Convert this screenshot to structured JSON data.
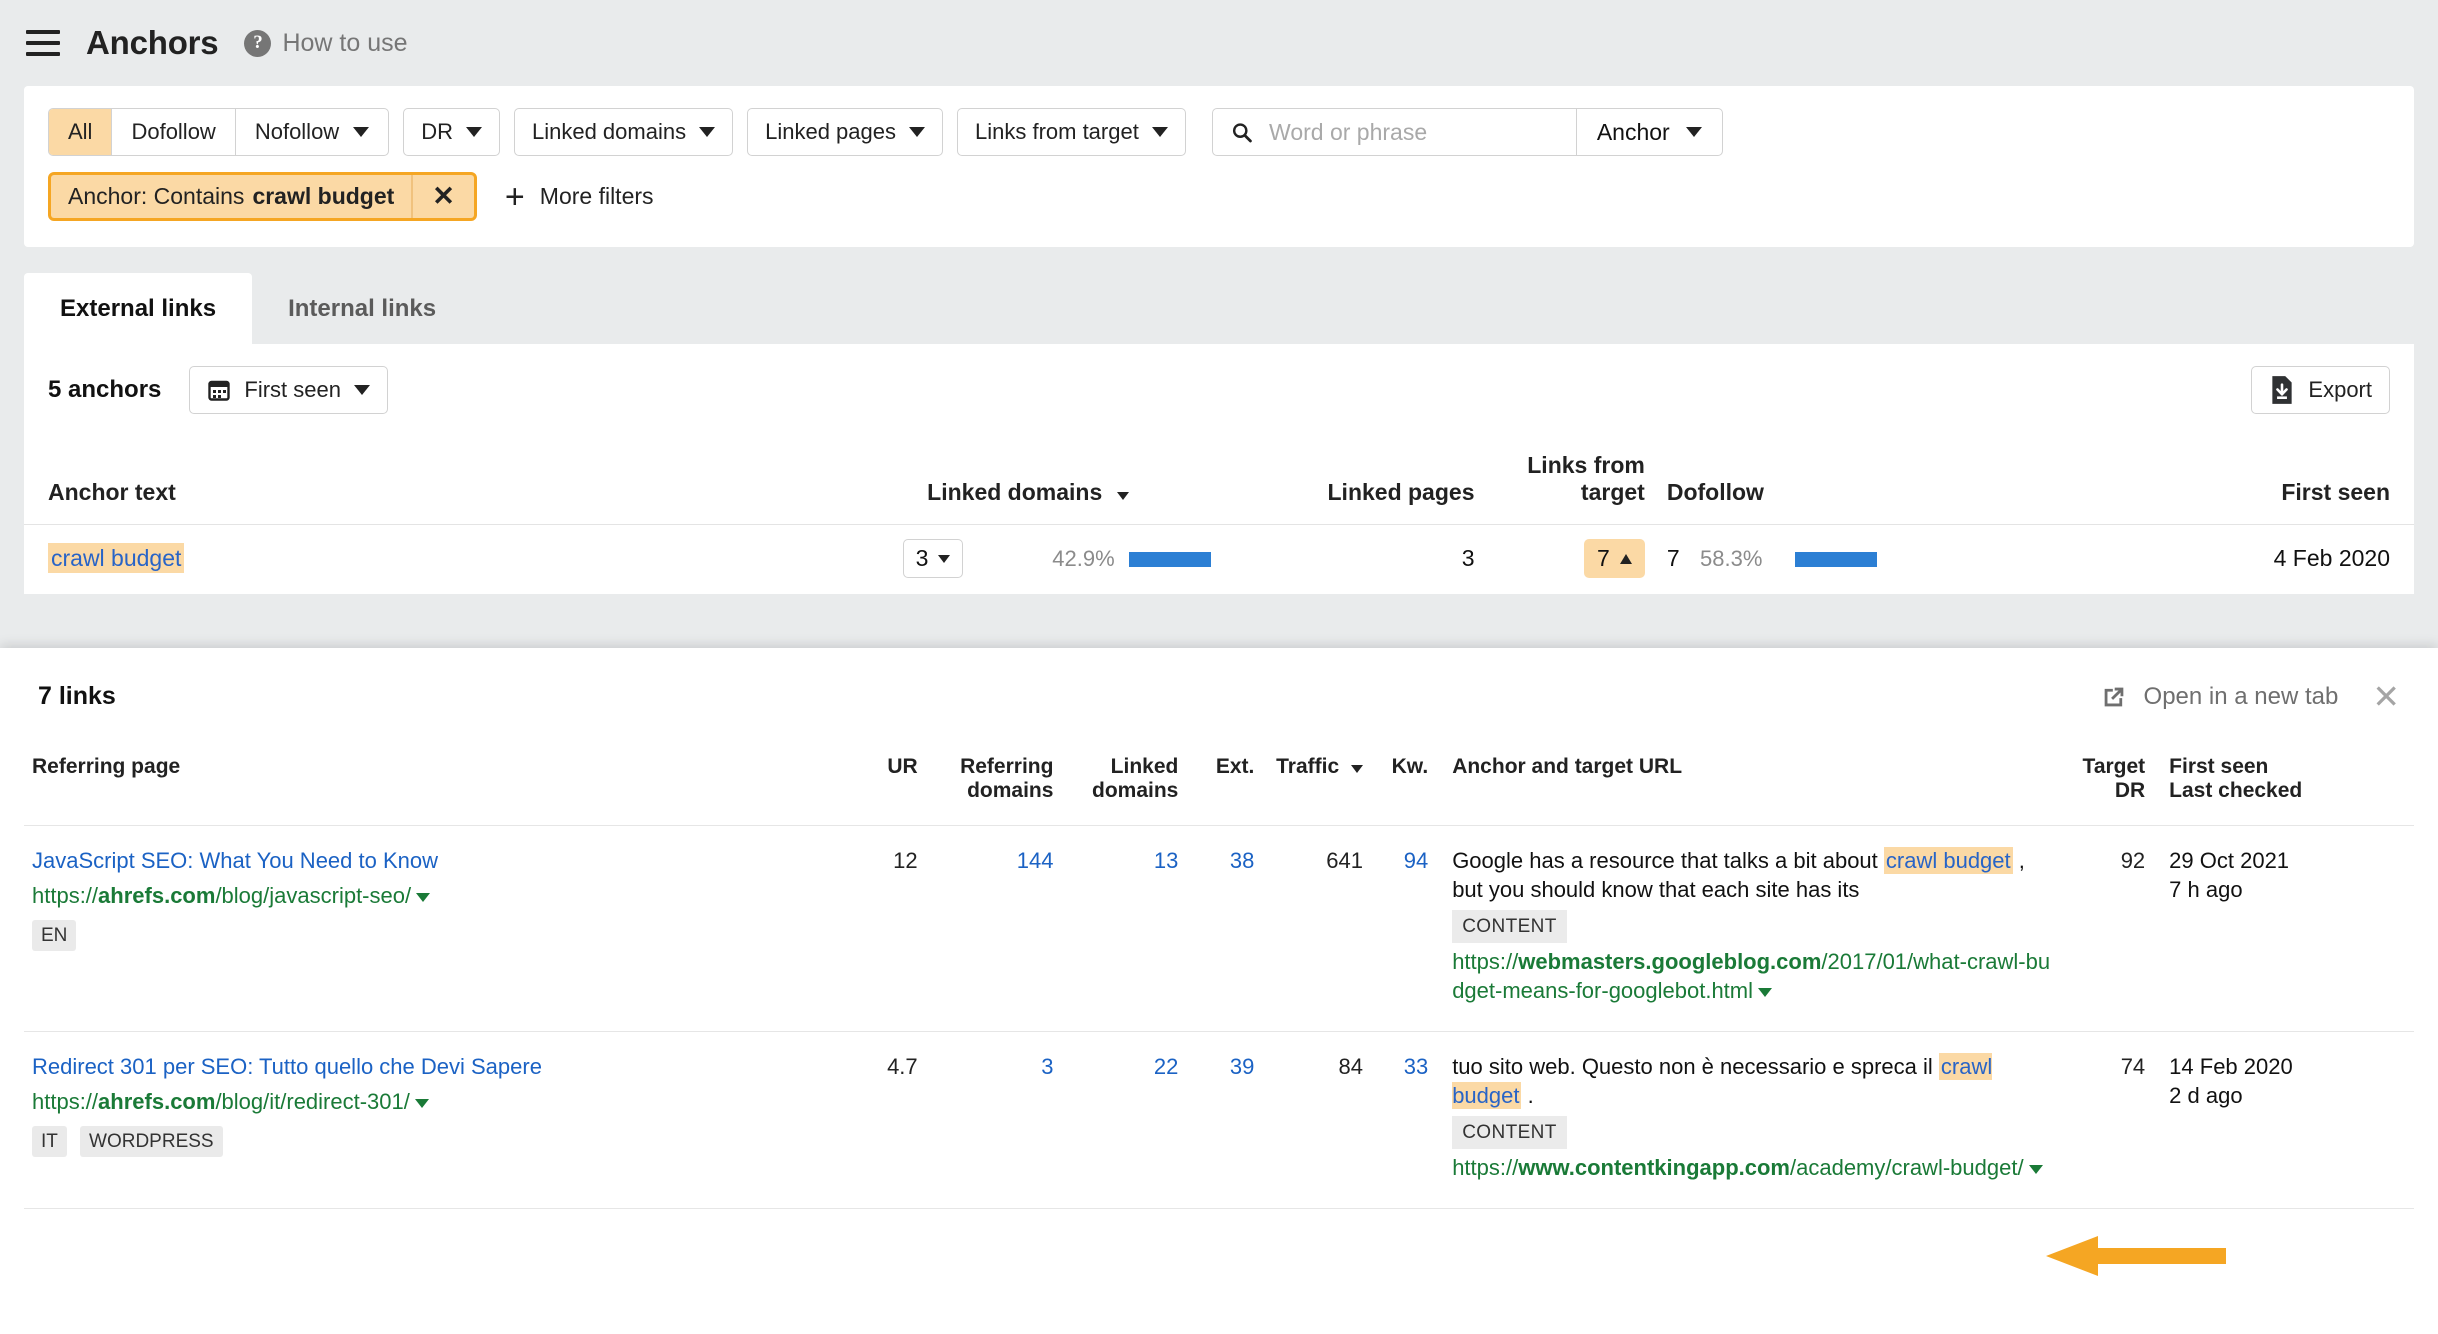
{
  "header": {
    "menu_icon": "hamburger-icon",
    "title": "Anchors",
    "help_icon": "question-circle-icon",
    "help_label": "How to use"
  },
  "filters": {
    "segments": [
      {
        "label": "All",
        "active": true
      },
      {
        "label": "Dofollow",
        "active": false
      },
      {
        "label": "Nofollow",
        "active": false,
        "caret": true
      }
    ],
    "dropdowns": [
      {
        "label": "DR"
      },
      {
        "label": "Linked domains"
      },
      {
        "label": "Linked pages"
      },
      {
        "label": "Links from target"
      }
    ],
    "search": {
      "icon": "search-icon",
      "placeholder": "Word or phrase",
      "value": "",
      "scope_label": "Anchor"
    },
    "chip": {
      "prefix": "Anchor: Contains",
      "value": "crawl budget",
      "close_icon": "close-icon"
    },
    "more_filters": {
      "icon": "plus-icon",
      "label": "More filters"
    }
  },
  "tabs": [
    {
      "label": "External links",
      "active": true
    },
    {
      "label": "Internal links",
      "active": false
    }
  ],
  "results_toolbar": {
    "count_label": "5 anchors",
    "date_filter": {
      "icon": "calendar-icon",
      "label": "First seen"
    },
    "export": {
      "icon": "export-icon",
      "label": "Export"
    }
  },
  "anchors_table": {
    "columns": [
      "Anchor text",
      "Linked domains",
      "Linked pages",
      "Links from target",
      "Dofollow",
      "First seen"
    ],
    "sorted_column": "Linked domains",
    "rows": [
      {
        "anchor_text": "crawl budget",
        "linked_domains": "3",
        "linked_domains_pct": "42.9%",
        "linked_domains_bar_pct": 43,
        "linked_pages": "3",
        "links_from_target": "7",
        "dofollow": "7",
        "dofollow_pct": "58.3%",
        "dofollow_bar_pct": 58,
        "first_seen": "4 Feb 2020"
      }
    ]
  },
  "links_panel": {
    "title": "7 links",
    "open_new_tab": {
      "icon": "external-link-icon",
      "label": "Open in a new tab"
    },
    "close_icon": "close-icon",
    "columns": {
      "referring_page": "Referring page",
      "ur": "UR",
      "referring_domains": [
        "Referring",
        "domains"
      ],
      "linked_domains": [
        "Linked",
        "domains"
      ],
      "ext": "Ext.",
      "traffic": "Traffic",
      "kw": "Kw.",
      "anchor_and_target_url": "Anchor and target URL",
      "target_dr": [
        "Target",
        "DR"
      ],
      "first_seen_last_checked": [
        "First seen",
        "Last checked"
      ]
    },
    "sorted_column": "Traffic",
    "rows": [
      {
        "title": "JavaScript SEO: What You Need to Know",
        "url_scheme": "https://",
        "url_domain": "ahrefs.com",
        "url_path": "/blog/javascript-seo/",
        "tags": [
          "EN"
        ],
        "ur": "12",
        "referring_domains": "144",
        "linked_domains": "13",
        "ext": "38",
        "traffic": "641",
        "kw": "94",
        "anchor_before": "Google has a resource that talks a bit about ",
        "anchor_highlight": "crawl budget",
        "anchor_after": " , but you should know that each site has its",
        "content_tag": "CONTENT",
        "target_scheme": "https://",
        "target_domain": "webmasters.googleblog.com",
        "target_path": "/2017/01/what-crawl-budget-means-for-googlebot.html",
        "target_dr": "92",
        "first_seen": "29 Oct 2021",
        "last_checked": "7 h ago"
      },
      {
        "title": "Redirect 301 per SEO: Tutto quello che Devi Sapere",
        "url_scheme": "https://",
        "url_domain": "ahrefs.com",
        "url_path": "/blog/it/redirect-301/",
        "tags": [
          "IT",
          "WORDPRESS"
        ],
        "ur": "4.7",
        "referring_domains": "3",
        "linked_domains": "22",
        "ext": "39",
        "traffic": "84",
        "kw": "33",
        "anchor_before": "tuo sito web. Questo non è necessario e spreca il ",
        "anchor_highlight": "crawl budget",
        "anchor_after": " .",
        "content_tag": "CONTENT",
        "target_scheme": "https://",
        "target_domain": "www.contentkingapp.com",
        "target_path": "/academy/crawl-budget/",
        "target_dr": "74",
        "first_seen": "14 Feb 2020",
        "last_checked": "2 d ago"
      }
    ]
  },
  "annotation": {
    "arrow_color": "#f5a623",
    "arrow_points_to": "target-url-row-2"
  },
  "colors": {
    "accent_orange": "#f5a623",
    "highlight_bg": "#fbd9a5",
    "link_blue": "#1b62c4",
    "url_green": "#1a7a37",
    "bar_blue": "#2c7fd4"
  }
}
